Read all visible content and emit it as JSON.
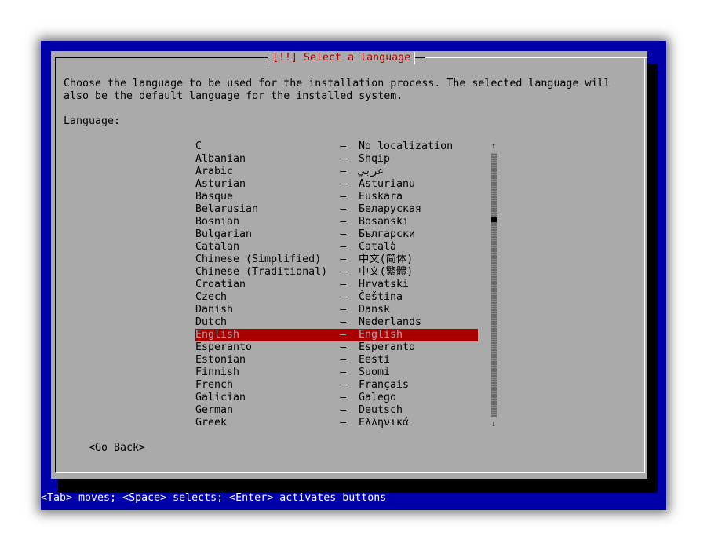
{
  "dialog": {
    "title": "[!!] Select a language",
    "description_line1": "Choose the language to be used for the installation process. The selected language will",
    "description_line2": "also be the default language for the installed system.",
    "field_label": "Language:"
  },
  "languages": [
    {
      "name": "C",
      "native": "No localization"
    },
    {
      "name": "Albanian",
      "native": "Shqip"
    },
    {
      "name": "Arabic",
      "native": "عربي"
    },
    {
      "name": "Asturian",
      "native": "Asturianu"
    },
    {
      "name": "Basque",
      "native": "Euskara"
    },
    {
      "name": "Belarusian",
      "native": "Беларуская"
    },
    {
      "name": "Bosnian",
      "native": "Bosanski"
    },
    {
      "name": "Bulgarian",
      "native": "Български"
    },
    {
      "name": "Catalan",
      "native": "Català"
    },
    {
      "name": "Chinese (Simplified)",
      "native": "中文(简体)"
    },
    {
      "name": "Chinese (Traditional)",
      "native": "中文(繁體)"
    },
    {
      "name": "Croatian",
      "native": "Hrvatski"
    },
    {
      "name": "Czech",
      "native": "Čeština"
    },
    {
      "name": "Danish",
      "native": "Dansk"
    },
    {
      "name": "Dutch",
      "native": "Nederlands"
    },
    {
      "name": "English",
      "native": "English"
    },
    {
      "name": "Esperanto",
      "native": "Esperanto"
    },
    {
      "name": "Estonian",
      "native": "Eesti"
    },
    {
      "name": "Finnish",
      "native": "Suomi"
    },
    {
      "name": "French",
      "native": "Français"
    },
    {
      "name": "Galician",
      "native": "Galego"
    },
    {
      "name": "German",
      "native": "Deutsch"
    },
    {
      "name": "Greek",
      "native": "Ελληνικά"
    }
  ],
  "separator": "–",
  "selected_language": "English",
  "scroll": {
    "up_arrow": "↑",
    "down_arrow": "↓"
  },
  "buttons": {
    "go_back": "<Go Back>"
  },
  "statusbar": {
    "text": "<Tab> moves; <Space> selects; <Enter> activates buttons"
  },
  "colors": {
    "screen_background": "#0000a8",
    "dialog_background": "#aaaaaa",
    "title_text": "#a80000",
    "selection_background": "#a80000",
    "selection_text": "#aaaaaa",
    "statusbar_text": "#ffffff"
  }
}
